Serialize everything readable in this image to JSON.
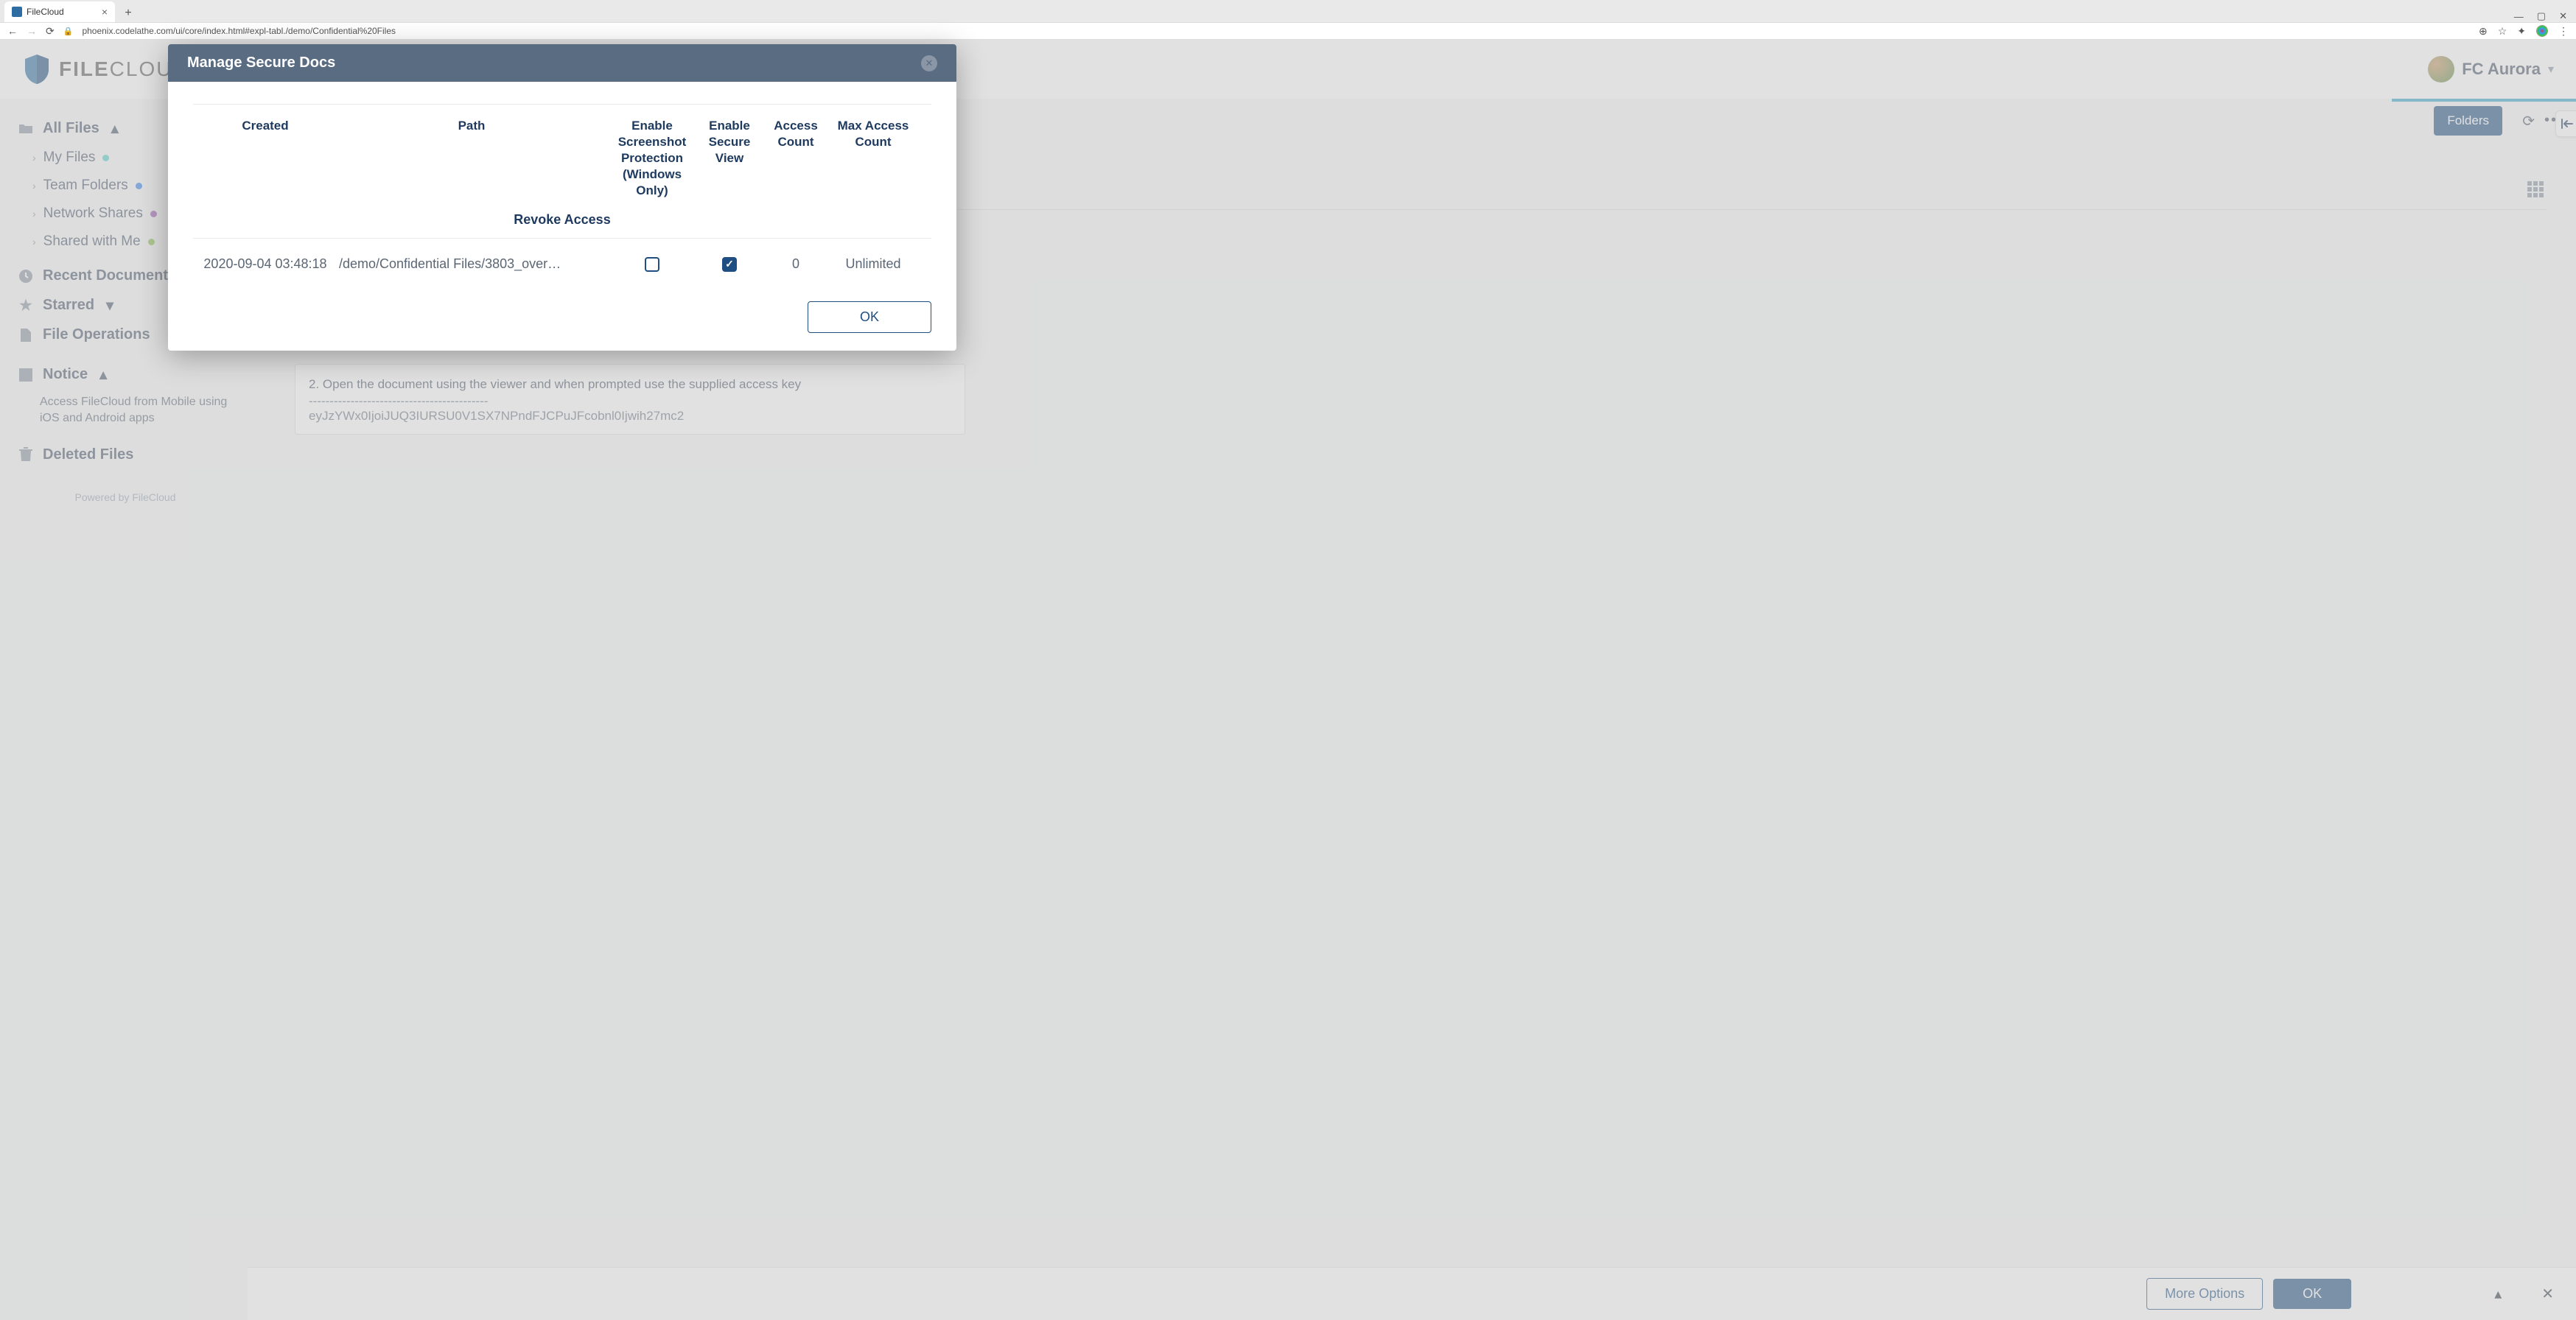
{
  "browser": {
    "tab_title": "FileCloud",
    "url": "phoenix.codelathe.com/ui/core/index.html#expl-tabl./demo/Confidential%20Files"
  },
  "header": {
    "logo_part1": "FILE",
    "logo_part2": "CLOUD",
    "user_name": "FC Aurora"
  },
  "sidebar": {
    "all_files": "All Files",
    "my_files": "My Files",
    "team_folders": "Team Folders",
    "network_shares": "Network Shares",
    "shared_with_me": "Shared with Me",
    "recent": "Recent Documents",
    "starred": "Starred",
    "file_ops": "File Operations",
    "notice": "Notice",
    "notice_body": "Access FileCloud from Mobile using iOS and Android apps",
    "deleted": "Deleted Files",
    "powered": "Powered by FileCloud"
  },
  "main": {
    "filter_btn": "Folders",
    "instruction": "2. Open the document using the viewer and when prompted use the supplied access key",
    "dashes": "-------------------------------------------",
    "token": "eyJzYWx0IjoiJUQ3IURSU0V1SX7NPndFJCPuJFcobnl0Ijwih27mc2"
  },
  "bottom_bar": {
    "more": "More Options",
    "ok": "OK"
  },
  "modal": {
    "title": "Manage Secure Docs",
    "col_created": "Created",
    "col_path": "Path",
    "col_screenshot": "Enable Screenshot Protection (Windows Only)",
    "col_secure_view": "Enable Secure View",
    "col_access_count": "Access Count",
    "col_max_access": "Max Access Count",
    "revoke": "Revoke Access",
    "row": {
      "created": "2020-09-04 03:48:18",
      "path": "/demo/Confidential Files/3803_over…",
      "screenshot_checked": false,
      "secure_view_checked": true,
      "access_count": "0",
      "max_access": "Unlimited"
    },
    "ok": "OK"
  }
}
